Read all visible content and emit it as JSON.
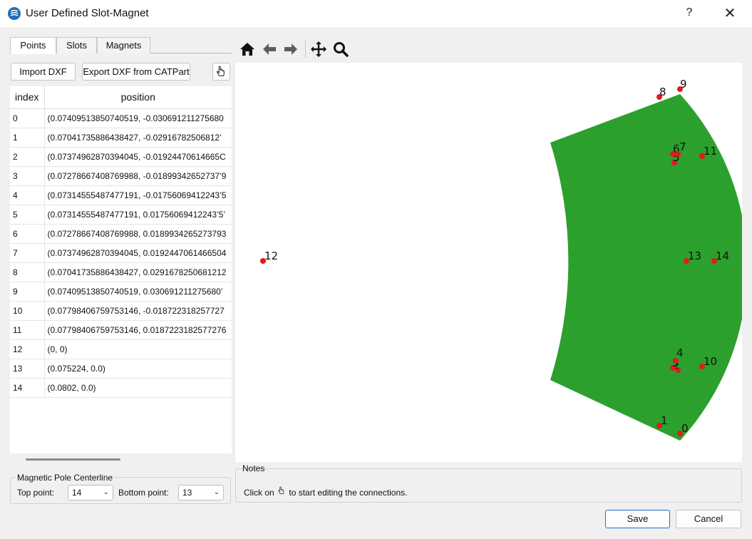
{
  "window": {
    "title": "User Defined Slot-Magnet",
    "help_label": "?",
    "close_label": "✕"
  },
  "tabs": [
    {
      "label": "Points",
      "active": true
    },
    {
      "label": "Slots",
      "active": false
    },
    {
      "label": "Magnets",
      "active": false
    }
  ],
  "actions": {
    "import_dxf": "Import DXF",
    "export_dxf": "Export DXF from CATPart"
  },
  "points_table": {
    "headers": [
      "index",
      "position"
    ],
    "rows": [
      [
        "0",
        "(0.07409513850740519, -0.030691211275680"
      ],
      [
        "1",
        "(0.07041735886438427, -0.02916782506812’"
      ],
      [
        "2",
        "(0.07374962870394045, -0.01924470614665C"
      ],
      [
        "3",
        "(0.07278667408769988, -0.01899342652737’9"
      ],
      [
        "4",
        "(0.07314555487477191, -0.01756069412243’5"
      ],
      [
        "5",
        "(0.07314555487477191, 0.01756069412243’5’"
      ],
      [
        "6",
        "(0.07278667408769988, 0.0189934265273793"
      ],
      [
        "7",
        "(0.07374962870394045, 0.0192447061466504"
      ],
      [
        "8",
        "(0.07041735886438427, 0.0291678250681212"
      ],
      [
        "9",
        "(0.07409513850740519, 0.030691211275680’"
      ],
      [
        "10",
        "(0.07798406759753146, -0.018722318257727"
      ],
      [
        "11",
        "(0.07798406759753146, 0.0187223182577276"
      ],
      [
        "12",
        "(0, 0)"
      ],
      [
        "13",
        "(0.075224, 0.0)"
      ],
      [
        "14",
        "(0.0802, 0.0)"
      ]
    ]
  },
  "centerline": {
    "title": "Magnetic Pole Centerline",
    "top_label": "Top point:",
    "top_value": "14",
    "bottom_label": "Bottom point:",
    "bottom_value": "13"
  },
  "toolbar": [
    "home-icon",
    "back-arrow-icon",
    "forward-arrow-icon",
    "pan-icon",
    "zoom-icon"
  ],
  "plot": {
    "fill_color": "#2ca02c",
    "point_color": "#e31a1c",
    "point_labels": [
      "0",
      "1",
      "2",
      "3",
      "4",
      "5",
      "6",
      "7",
      "8",
      "9",
      "10",
      "11",
      "12",
      "13",
      "14"
    ]
  },
  "notes": {
    "title": "Notes",
    "text_before": "Click on",
    "text_after": "to start editing the connections."
  },
  "footer": {
    "save": "Save",
    "cancel": "Cancel"
  }
}
